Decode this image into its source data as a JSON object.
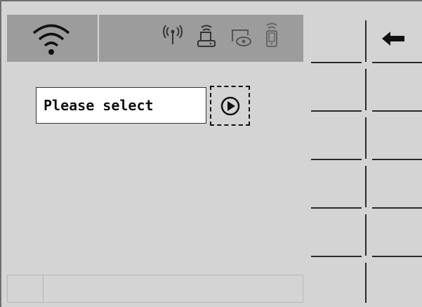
{
  "status_bar": {
    "icons": [
      "wifi-icon",
      "antenna-signal-icon",
      "router-icon",
      "screen-view-icon",
      "phone-wireless-icon"
    ]
  },
  "selector": {
    "value": "Please select",
    "action_icon": "play-icon"
  },
  "softkeys": {
    "top_right_icon": "back-arrow-icon"
  },
  "colors": {
    "background": "#d4d4d4",
    "status_bar": "#9c9c9c",
    "input_background": "#ffffff",
    "lines": "#2a2a2a"
  }
}
